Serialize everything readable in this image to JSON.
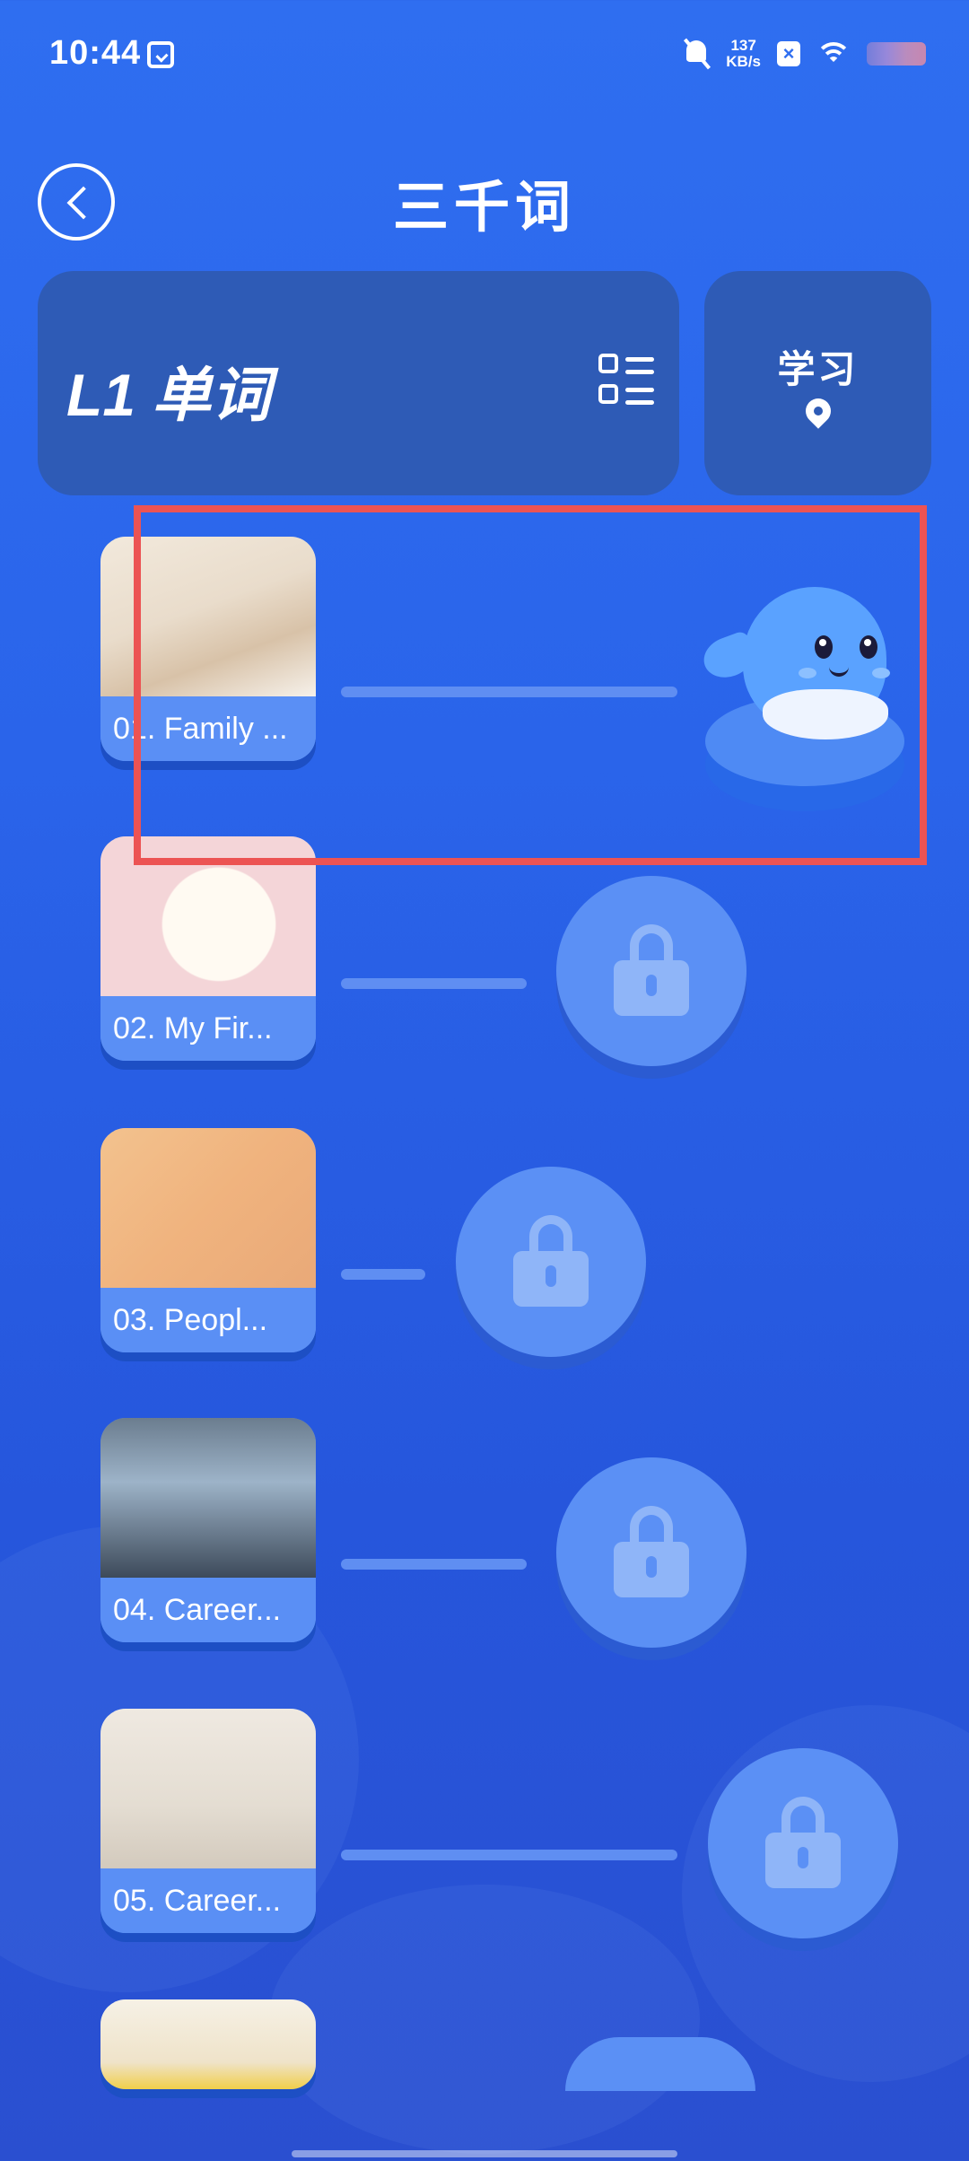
{
  "status_bar": {
    "time": "10:44",
    "net_speed_value": "137",
    "net_speed_unit": "KB/s"
  },
  "header": {
    "title": "三千词"
  },
  "level_card": {
    "title": "L1 单词"
  },
  "study_card": {
    "label": "学习"
  },
  "lessons": [
    {
      "label": "01. Family ...",
      "locked": false,
      "current": true
    },
    {
      "label": "02. My Fir...",
      "locked": true
    },
    {
      "label": "03. Peopl...",
      "locked": true
    },
    {
      "label": "04. Career...",
      "locked": true
    },
    {
      "label": "05. Career...",
      "locked": true
    },
    {
      "label": "",
      "locked": true
    }
  ],
  "colors": {
    "background": "#2f6ef0",
    "card": "#2e5bb6",
    "node": "#5b90f5",
    "highlight": "#ec5353"
  }
}
